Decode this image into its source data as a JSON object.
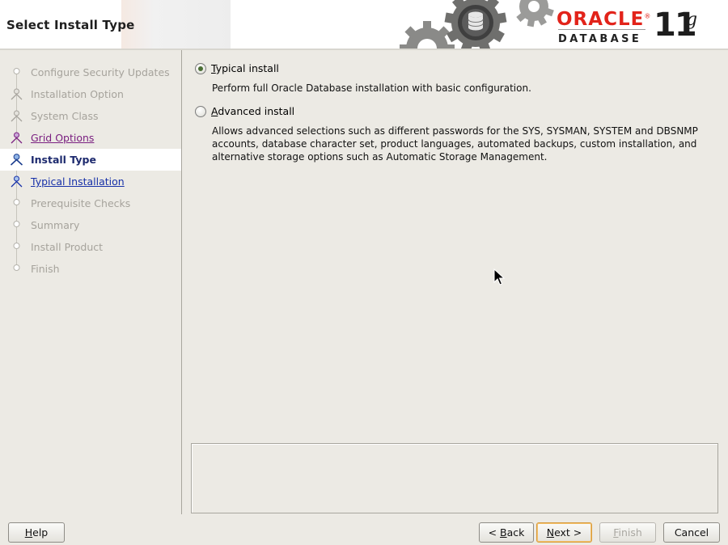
{
  "header": {
    "title": "Select Install Type",
    "brand": {
      "oracle": "ORACLE",
      "reg": "®",
      "database": "DATABASE",
      "version": "11",
      "version_suffix": "g"
    }
  },
  "sidebar": {
    "steps": [
      {
        "label": "Configure Security Updates",
        "state": "disabled"
      },
      {
        "label": "Installation Option",
        "state": "disabled"
      },
      {
        "label": "System Class",
        "state": "disabled"
      },
      {
        "label": "Grid Options",
        "state": "visited"
      },
      {
        "label": "Install Type",
        "state": "active"
      },
      {
        "label": "Typical Installation",
        "state": "link"
      },
      {
        "label": "Prerequisite Checks",
        "state": "disabled"
      },
      {
        "label": "Summary",
        "state": "disabled"
      },
      {
        "label": "Install Product",
        "state": "disabled"
      },
      {
        "label": "Finish",
        "state": "disabled"
      }
    ]
  },
  "main": {
    "options": [
      {
        "mnemonic": "T",
        "rest": "ypical install",
        "selected": true,
        "description": "Perform full Oracle Database installation with basic configuration."
      },
      {
        "mnemonic": "A",
        "rest": "dvanced install",
        "selected": false,
        "description": "Allows advanced selections such as different passwords for the SYS, SYSMAN, SYSTEM and DBSNMP accounts, database character set, product languages, automated backups, custom installation, and alternative storage options such as Automatic Storage Management."
      }
    ]
  },
  "footer": {
    "help": {
      "mnemonic": "H",
      "rest": "elp"
    },
    "back": {
      "prefix": "< ",
      "mnemonic": "B",
      "rest": "ack"
    },
    "next": {
      "mnemonic": "N",
      "rest": "ext >"
    },
    "finish": {
      "mnemonic": "F",
      "rest": "inish"
    },
    "cancel": {
      "label": "Cancel"
    }
  },
  "colors": {
    "oracle_red": "#e2231a",
    "active_step": "#1d2a6e",
    "visited_link": "#7a1f80",
    "link": "#1630a8",
    "disabled_text": "#a6a39c"
  }
}
